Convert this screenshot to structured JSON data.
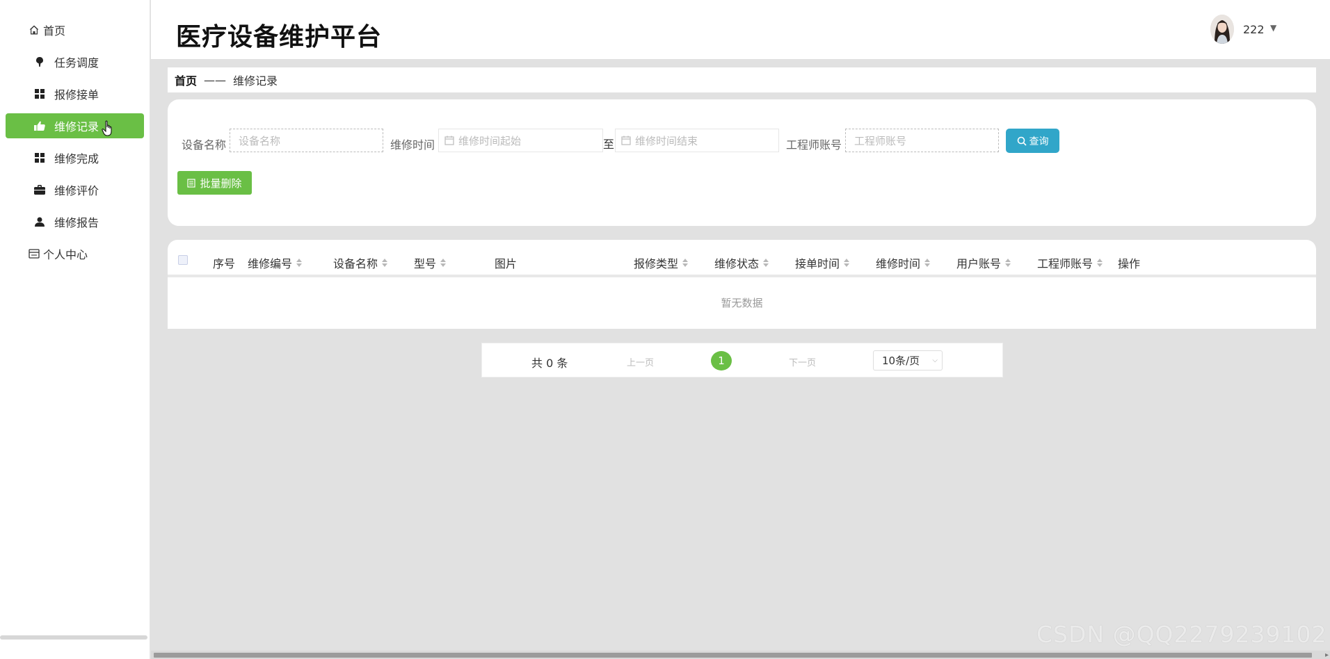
{
  "sidebar": {
    "items": [
      {
        "label": "首页",
        "icon": "home-icon",
        "level": "top"
      },
      {
        "label": "任务调度",
        "icon": "pin-icon",
        "level": "sub"
      },
      {
        "label": "报修接单",
        "icon": "grid-icon",
        "level": "sub"
      },
      {
        "label": "维修记录",
        "icon": "thumb-icon",
        "level": "sub",
        "active": true
      },
      {
        "label": "维修完成",
        "icon": "grid-icon",
        "level": "sub"
      },
      {
        "label": "维修评价",
        "icon": "briefcase-icon",
        "level": "sub"
      },
      {
        "label": "维修报告",
        "icon": "user-icon",
        "level": "sub"
      },
      {
        "label": "个人中心",
        "icon": "window-icon",
        "level": "top"
      }
    ]
  },
  "header": {
    "title": "医疗设备维护平台",
    "user": "222"
  },
  "breadcrumb": {
    "home": "首页",
    "separator": "——",
    "current": "维修记录"
  },
  "search": {
    "device_name_label": "设备名称",
    "device_name_placeholder": "设备名称",
    "repair_time_label": "维修时间",
    "repair_time_start_placeholder": "维修时间起始",
    "to_text": "至",
    "repair_time_end_placeholder": "维修时间结束",
    "engineer_label": "工程师账号",
    "engineer_placeholder": "工程师账号",
    "query_button": "查询",
    "batch_delete_button": "批量删除"
  },
  "table": {
    "columns": [
      {
        "label": "序号",
        "sortable": false
      },
      {
        "label": "维修编号",
        "sortable": true
      },
      {
        "label": "设备名称",
        "sortable": true
      },
      {
        "label": "型号",
        "sortable": true
      },
      {
        "label": "图片",
        "sortable": false
      },
      {
        "label": "报修类型",
        "sortable": true
      },
      {
        "label": "维修状态",
        "sortable": true
      },
      {
        "label": "接单时间",
        "sortable": true
      },
      {
        "label": "维修时间",
        "sortable": true
      },
      {
        "label": "用户账号",
        "sortable": true
      },
      {
        "label": "工程师账号",
        "sortable": true
      },
      {
        "label": "操作",
        "sortable": false
      }
    ],
    "empty_text": "暂无数据"
  },
  "pagination": {
    "total": "共 0 条",
    "prev": "上一页",
    "current_page": "1",
    "next": "下一页",
    "page_size": "10条/页"
  },
  "watermark": "CSDN @QQ2279239102",
  "colors": {
    "accent_green": "#6abf45",
    "query_blue": "#31a6c9",
    "page_bg": "#e1e1e1"
  }
}
